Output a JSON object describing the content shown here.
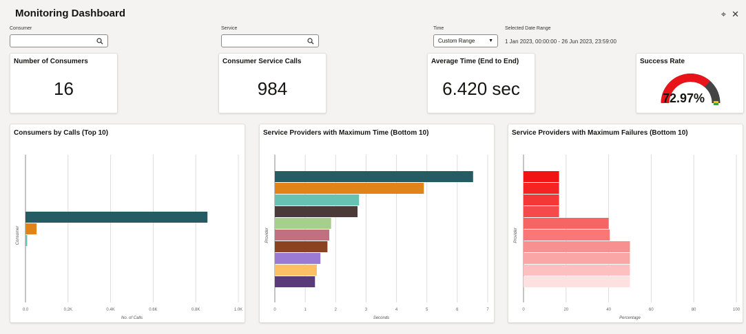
{
  "header": {
    "title": "Monitoring Dashboard"
  },
  "filters": {
    "consumer_label": "Consumer",
    "consumer_value": "",
    "service_label": "Service",
    "service_value": "",
    "time_label": "Time",
    "time_value": "Custom Range",
    "range_label": "Selected Date Range",
    "range_value": "1 Jan 2023, 00:00:00 - 26 Jun 2023, 23:59:00"
  },
  "kpis": {
    "consumers_title": "Number of Consumers",
    "consumers_value": "16",
    "calls_title": "Consumer Service Calls",
    "calls_value": "984",
    "avg_title": "Average Time (End to End)",
    "avg_value": "6.420 sec",
    "success_title": "Success Rate",
    "success_value": "72.97%",
    "success_fraction": 0.7297
  },
  "colors": {
    "teal": "#255c63",
    "orange": "#e0841a",
    "gauge_red": "#e8141a",
    "gauge_yellow": "#f5c400",
    "gauge_green": "#3aa13a"
  },
  "chart_data": [
    {
      "type": "bar",
      "orientation": "horizontal",
      "title": "Consumers by Calls (Top 10)",
      "xlabel": "No. of Calls",
      "ylabel": "Consumer",
      "xlim": [
        0,
        1000
      ],
      "xticks": [
        "0.0",
        "0.2K",
        "0.4K",
        "0.6K",
        "0.8K",
        "1.0K"
      ],
      "values": [
        855,
        52,
        8
      ],
      "colors": [
        "#255c63",
        "#e0841a",
        "#68c2b3"
      ],
      "grid": true
    },
    {
      "type": "bar",
      "orientation": "horizontal",
      "title": "Service Providers with Maximum Time (Bottom 10)",
      "xlabel": "Seconds",
      "ylabel": "Provider",
      "xlim": [
        0,
        7
      ],
      "xticks": [
        "0",
        "1",
        "2",
        "3",
        "4",
        "5",
        "6",
        "7"
      ],
      "values": [
        6.52,
        4.9,
        2.77,
        2.72,
        1.85,
        1.79,
        1.73,
        1.5,
        1.38,
        1.32
      ],
      "colors": [
        "#255c63",
        "#e0841a",
        "#68c2b3",
        "#4a3b38",
        "#a7cf8c",
        "#c07080",
        "#8a4220",
        "#9b7ad3",
        "#fbbf65",
        "#5a3a78"
      ],
      "grid": true
    },
    {
      "type": "bar",
      "orientation": "horizontal",
      "title": "Service Providers with Maximum Failures (Bottom 10)",
      "xlabel": "Percentage",
      "ylabel": "Provider",
      "xlim": [
        0,
        100
      ],
      "xticks": [
        "0",
        "20",
        "40",
        "60",
        "80",
        "100"
      ],
      "values": [
        16.7,
        16.7,
        16.7,
        16.7,
        40,
        40.5,
        50,
        50,
        50,
        50
      ],
      "colors": [
        "#f01414",
        "#f42424",
        "#f43838",
        "#f54a4a",
        "#f76464",
        "#f87878",
        "#f99090",
        "#fba6a6",
        "#fcc0c0",
        "#fde0e0"
      ],
      "grid": true
    }
  ]
}
